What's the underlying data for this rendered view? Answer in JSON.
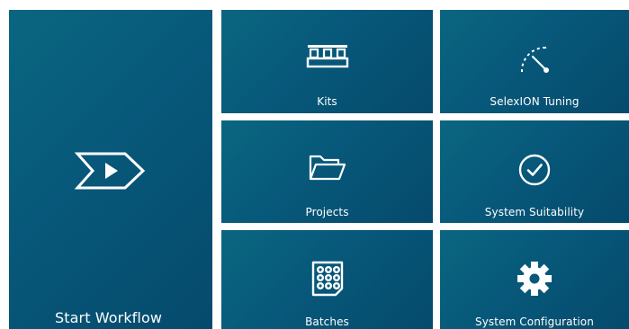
{
  "tiles": {
    "start_workflow": {
      "label": "Start Workflow",
      "icon": "start-workflow-icon"
    },
    "kits": {
      "label": "Kits",
      "icon": "kits-icon"
    },
    "selexion_tuning": {
      "label": "SelexION Tuning",
      "icon": "gauge-icon"
    },
    "projects": {
      "label": "Projects",
      "icon": "folder-icon"
    },
    "system_suitability": {
      "label": "System Suitability",
      "icon": "check-circle-icon"
    },
    "batches": {
      "label": "Batches",
      "icon": "batch-plate-icon"
    },
    "system_configuration": {
      "label": "System Configuration",
      "icon": "gear-icon"
    }
  },
  "colors": {
    "tile_background": "#07587a",
    "tile_foreground": "#ffffff",
    "gutter": "#ffffff"
  }
}
